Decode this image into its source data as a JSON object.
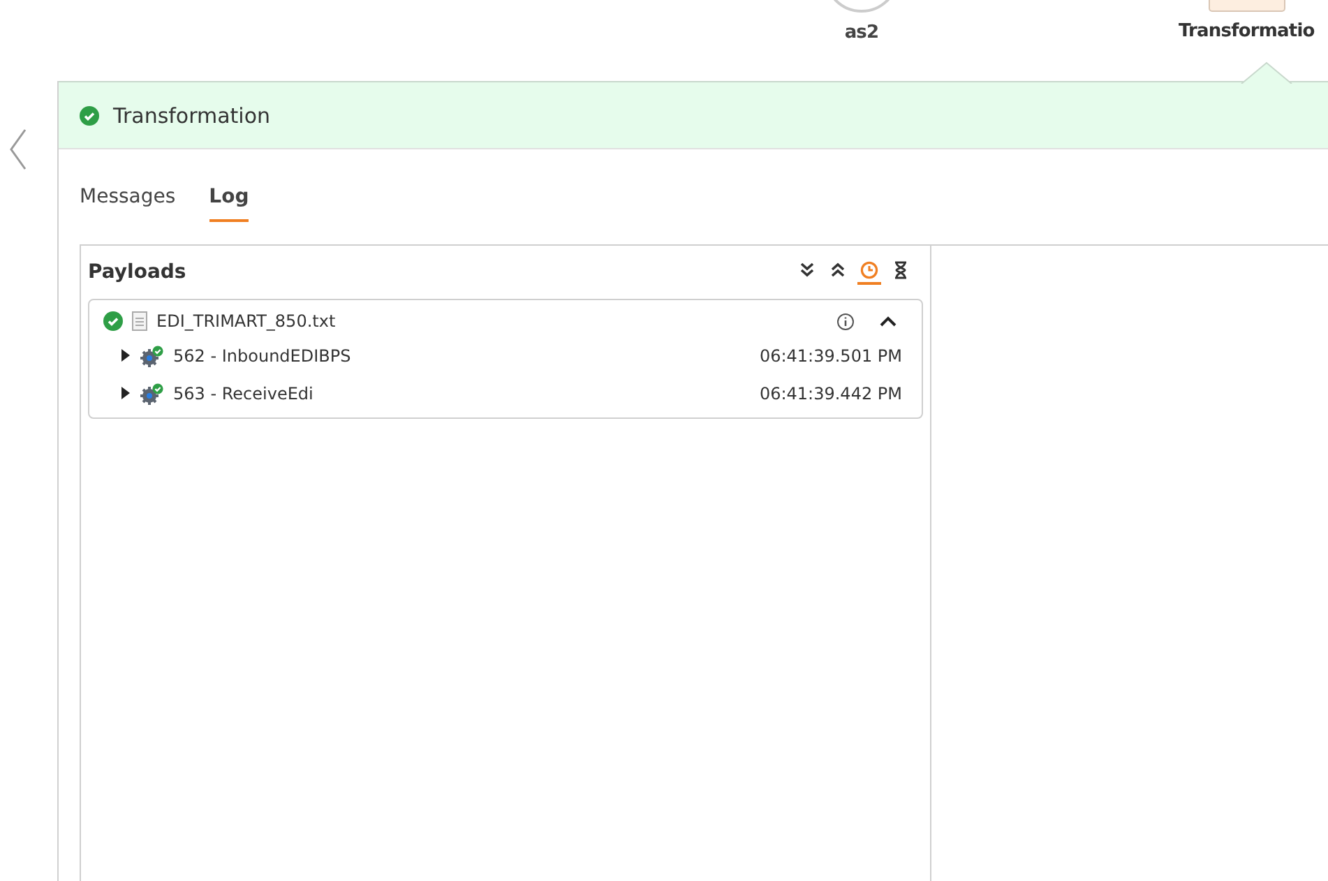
{
  "steps": [
    {
      "label": "as2",
      "kind": "circle",
      "selected": false
    },
    {
      "label": "Transformatio",
      "kind": "box",
      "selected": true
    }
  ],
  "status": {
    "title": "Transformation",
    "ok": true
  },
  "tabs": [
    {
      "label": "Messages",
      "selected": false
    },
    {
      "label": "Log",
      "selected": true
    }
  ],
  "payloads": {
    "title": "Payloads",
    "tools": [
      {
        "kind": "expand",
        "selected": false
      },
      {
        "kind": "collapse",
        "selected": false
      },
      {
        "kind": "clock",
        "selected": true
      },
      {
        "kind": "hourglass",
        "selected": false
      }
    ],
    "file": {
      "name": "EDI_TRIMART_850.txt",
      "ok": true,
      "expanded": true,
      "children": [
        {
          "label": "562 - InboundEDIBPS",
          "time": "06:41:39.501 PM",
          "expanded": false
        },
        {
          "label": "563 - ReceiveEdi",
          "time": "06:41:39.442 PM",
          "expanded": false
        }
      ]
    }
  }
}
